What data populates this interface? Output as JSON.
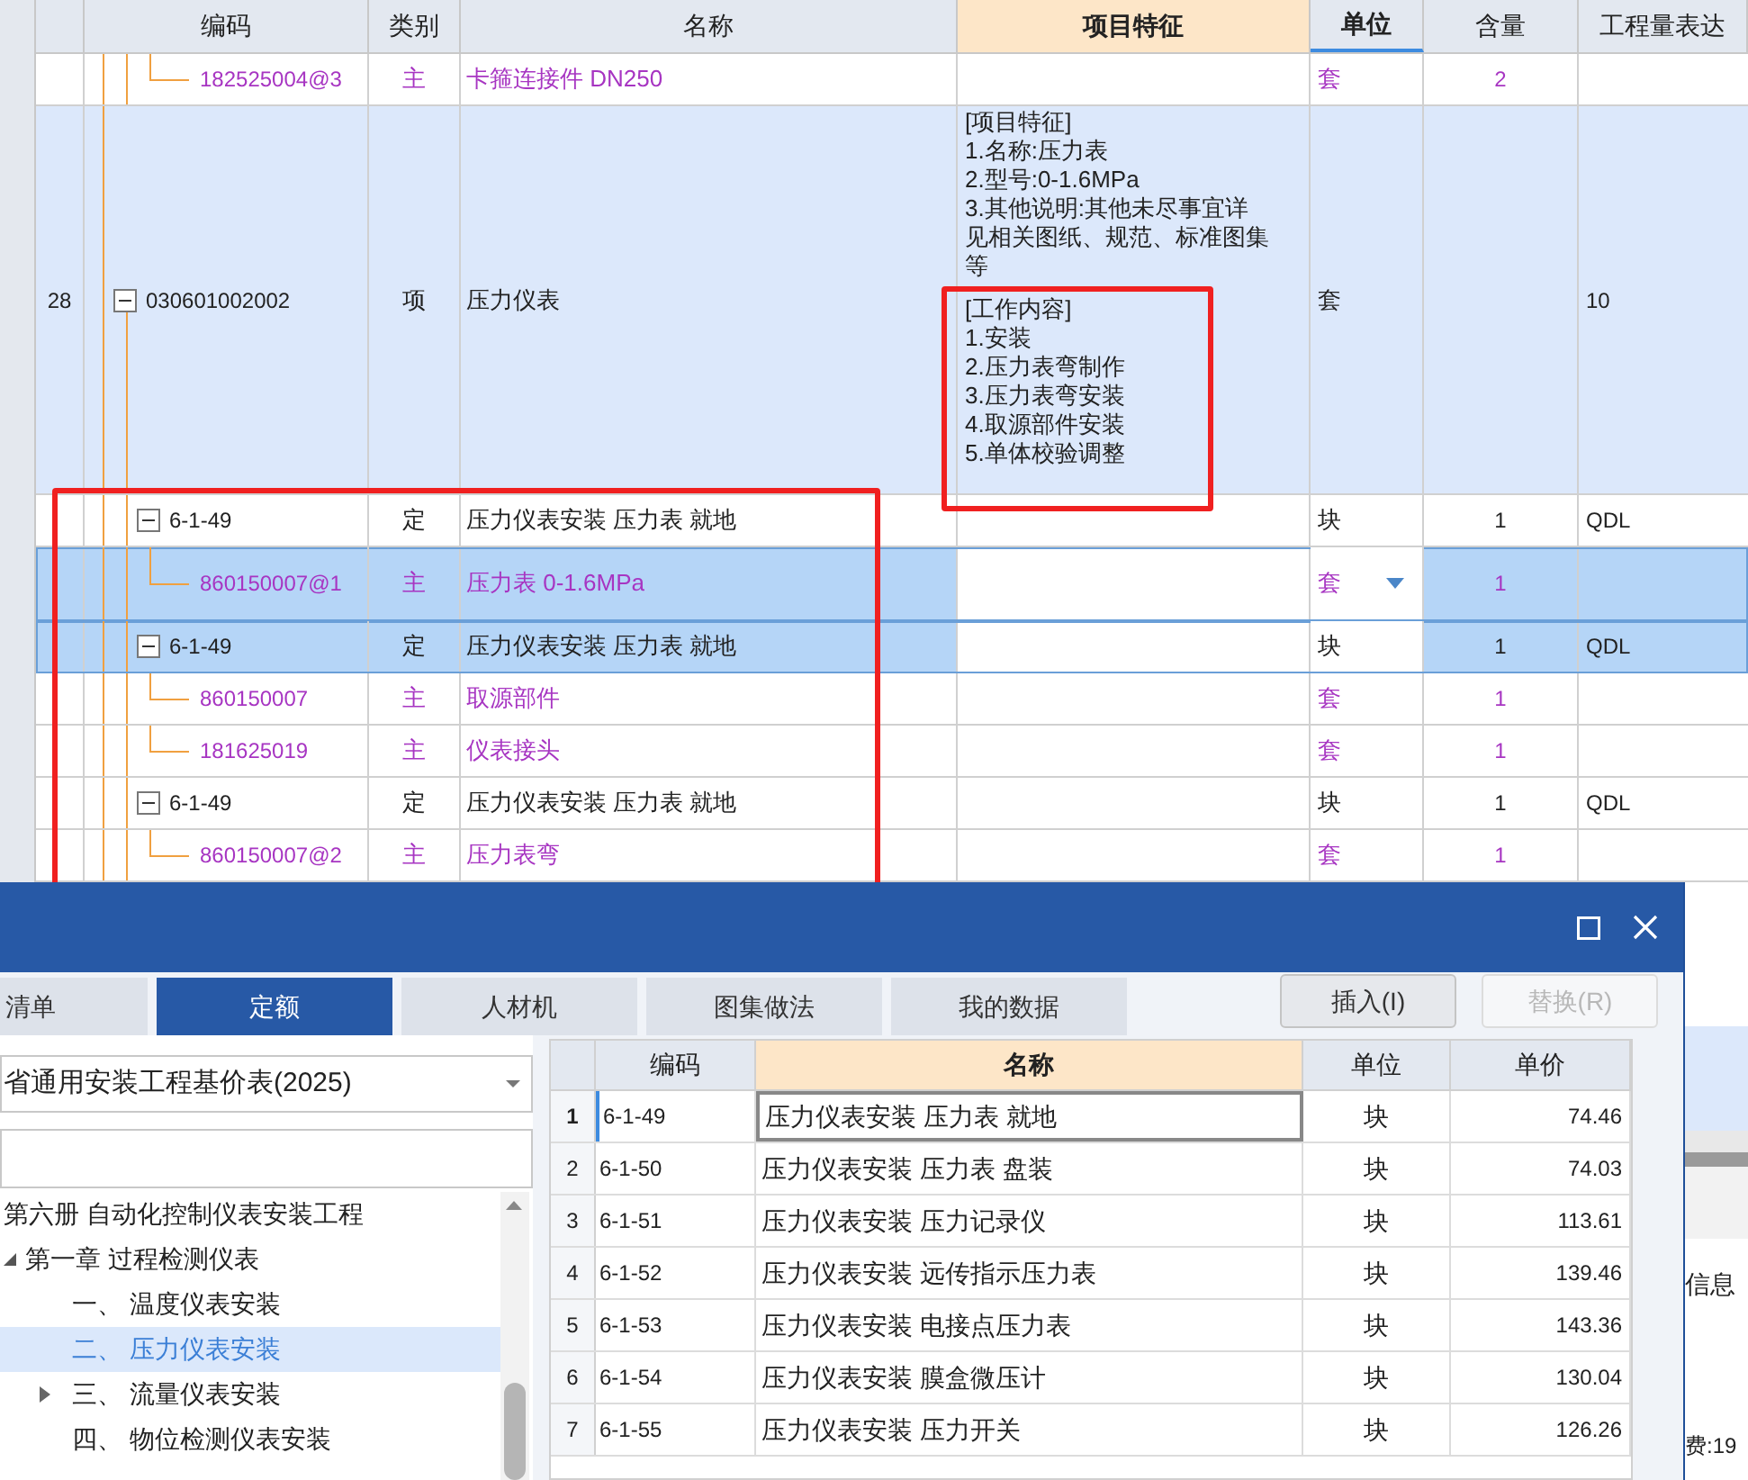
{
  "grid": {
    "columns": [
      {
        "label": "编码",
        "selected": false,
        "active": false
      },
      {
        "label": "类别",
        "selected": false,
        "active": false
      },
      {
        "label": "名称",
        "selected": false,
        "active": false
      },
      {
        "label": "项目特征",
        "selected": true,
        "active": false
      },
      {
        "label": "单位",
        "selected": false,
        "active": true
      },
      {
        "label": "含量",
        "selected": false,
        "active": false
      },
      {
        "label": "工程量表达",
        "selected": false,
        "active": false
      }
    ],
    "rows": [
      {
        "code": "182525004@3",
        "category": "主",
        "kind": "material",
        "name": "卡箍连接件 DN250",
        "unit": "套",
        "qty": "2",
        "selected": false
      },
      {
        "num": "28",
        "code": "030601002002",
        "category": "项",
        "kind": "item",
        "name": "压力仪表",
        "unit": "套",
        "expr": "10",
        "expanded": true,
        "selected": false,
        "highlighted": true,
        "feature": [
          {
            "heading": "[项目特征]",
            "lines": [
              "1.名称:压力表",
              "2.型号:0-1.6MPa",
              "3.其他说明:其他未尽事宜详见相关图纸、规范、标准图集等"
            ]
          },
          {
            "heading": "[工作内容]",
            "lines": [
              "1.安装",
              "2.压力表弯制作",
              "3.压力表弯安装",
              "4.取源部件安装",
              "5.单体校验调整"
            ]
          }
        ],
        "children": [
          {
            "code": "6-1-49",
            "category": "定",
            "kind": "quota",
            "name": "压力仪表安装 压力表 就地",
            "unit": "块",
            "qty": "1",
            "expr": "QDL",
            "expanded": true,
            "selected": false,
            "children": [
              {
                "code": "860150007@1",
                "category": "主",
                "kind": "material",
                "name": "压力表 0-1.6MPa",
                "unit": "套",
                "qty": "1",
                "selected": true,
                "editing": true
              }
            ]
          },
          {
            "code": "6-1-49",
            "category": "定",
            "kind": "quota",
            "name": "压力仪表安装 压力表 就地",
            "unit": "块",
            "qty": "1",
            "expr": "QDL",
            "expanded": true,
            "selected": true,
            "children": [
              {
                "code": "860150007",
                "category": "主",
                "kind": "material",
                "name": "取源部件",
                "unit": "套",
                "qty": "1",
                "selected": false
              },
              {
                "code": "181625019",
                "category": "主",
                "kind": "material",
                "name": "仪表接头",
                "unit": "套",
                "qty": "1",
                "selected": false
              }
            ]
          },
          {
            "code": "6-1-49",
            "category": "定",
            "kind": "quota",
            "name": "压力仪表安装 压力表 就地",
            "unit": "块",
            "qty": "1",
            "expr": "QDL",
            "expanded": true,
            "selected": false,
            "children": [
              {
                "code": "860150007@2",
                "category": "主",
                "kind": "material",
                "name": "压力表弯",
                "unit": "套",
                "qty": "1",
                "selected": false
              }
            ]
          }
        ]
      }
    ]
  },
  "side_panel": {
    "label": "信息",
    "footer": "费:19"
  },
  "dialog": {
    "tabs": [
      {
        "label": "清单",
        "selected": false
      },
      {
        "label": "定额",
        "selected": true
      },
      {
        "label": "人材机",
        "selected": false
      },
      {
        "label": "图集做法",
        "selected": false
      },
      {
        "label": "我的数据",
        "selected": false
      }
    ],
    "buttons": [
      {
        "label": "插入(I)",
        "disabled": false
      },
      {
        "label": "替换(R)",
        "disabled": true
      }
    ],
    "library": {
      "value": "省通用安装工程基价表(2025)"
    },
    "tree": [
      {
        "label": "第六册 自动化控制仪表安装工程",
        "kind": "root",
        "children": [
          {
            "label": "第一章 过程检测仪表",
            "kind": "folder",
            "expanded": true,
            "children": [
              {
                "label": "一、 温度仪表安装",
                "kind": "leaf",
                "selected": false
              },
              {
                "label": "二、 压力仪表安装",
                "kind": "leaf",
                "selected": true
              },
              {
                "label": "三、 流量仪表安装",
                "kind": "folder",
                "expanded": false,
                "selected": false
              },
              {
                "label": "四、 物位检测仪表安装",
                "kind": "leaf",
                "selected": false
              }
            ]
          }
        ]
      }
    ],
    "table": {
      "columns": [
        "编码",
        "名称",
        "单位",
        "单价"
      ],
      "rows": [
        {
          "num": "1",
          "code": "6-1-49",
          "name": "压力仪表安装 压力表 就地",
          "unit": "块",
          "price": "74.46",
          "selected": true
        },
        {
          "num": "2",
          "code": "6-1-50",
          "name": "压力仪表安装 压力表 盘装",
          "unit": "块",
          "price": "74.03",
          "selected": false
        },
        {
          "num": "3",
          "code": "6-1-51",
          "name": "压力仪表安装 压力记录仪",
          "unit": "块",
          "price": "113.61",
          "selected": false
        },
        {
          "num": "4",
          "code": "6-1-52",
          "name": "压力仪表安装 远传指示压力表",
          "unit": "块",
          "price": "139.46",
          "selected": false
        },
        {
          "num": "5",
          "code": "6-1-53",
          "name": "压力仪表安装 电接点压力表",
          "unit": "块",
          "price": "143.36",
          "selected": false
        },
        {
          "num": "6",
          "code": "6-1-54",
          "name": "压力仪表安装 膜盒微压计",
          "unit": "块",
          "price": "130.04",
          "selected": false
        },
        {
          "num": "7",
          "code": "6-1-55",
          "name": "压力仪表安装 压力开关",
          "unit": "块",
          "price": "126.26",
          "selected": false
        }
      ]
    }
  }
}
